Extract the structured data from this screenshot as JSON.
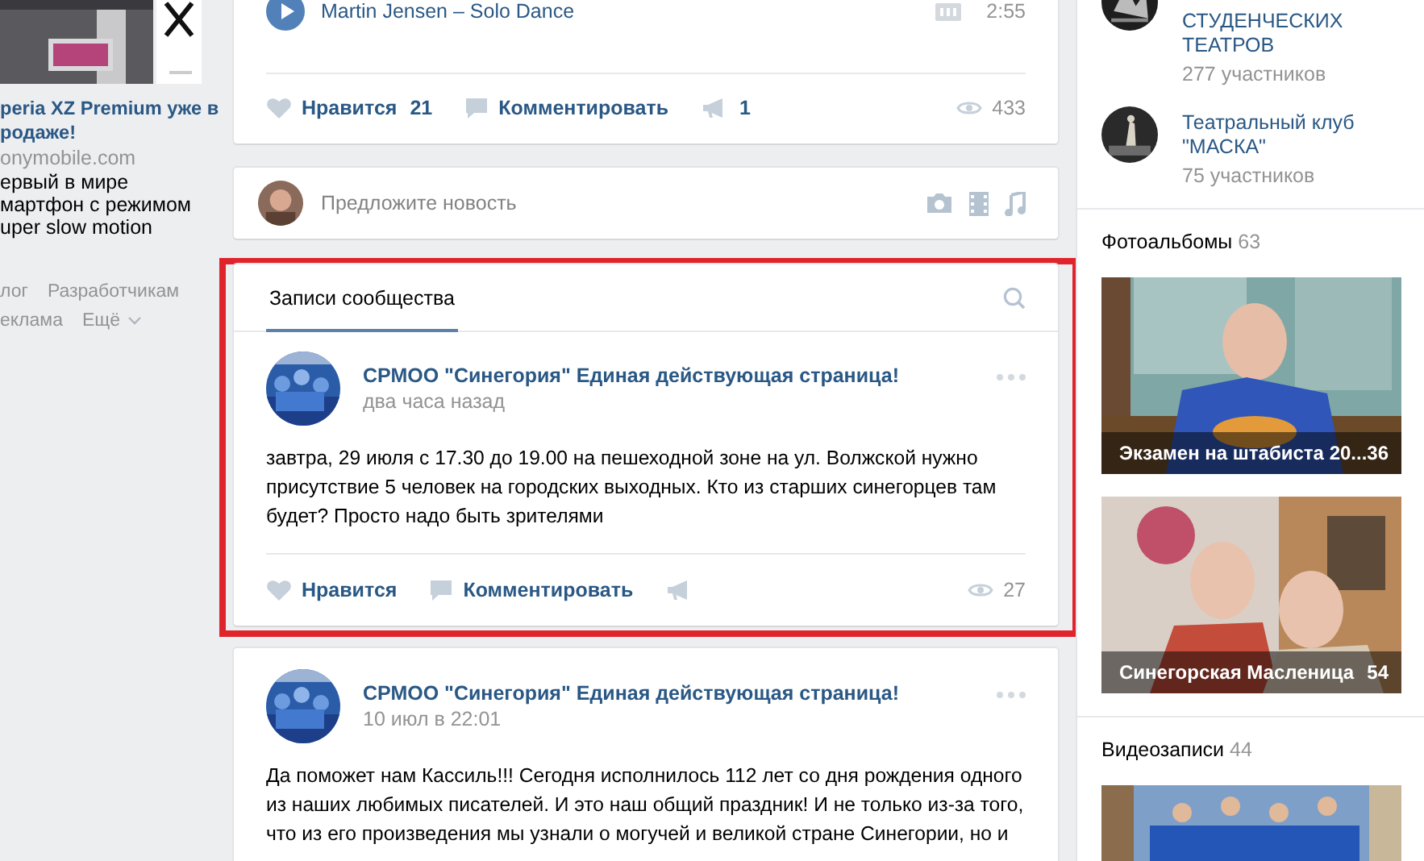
{
  "left_ad": {
    "title_lines": [
      "peria XZ Premium уже в",
      "родаже!"
    ],
    "domain": "onymobile.com",
    "description_lines": [
      "ервый в мире",
      "мартфон с режимом",
      "uper slow motion"
    ]
  },
  "footer_links": [
    {
      "label": "лог",
      "kind": "link"
    },
    {
      "label": "Разработчикам",
      "kind": "link"
    },
    {
      "label": "еклама",
      "kind": "link"
    },
    {
      "label": "Ещё",
      "kind": "menu"
    }
  ],
  "top_post": {
    "audio": {
      "title": "Martin Jensen – Solo Dance",
      "duration": "2:55"
    },
    "like_label": "Нравится",
    "like_count": "21",
    "comment_label": "Комментировать",
    "share_count": "1",
    "views": "433"
  },
  "suggest": {
    "placeholder": "Предложите новость"
  },
  "wall": {
    "highlighted": true,
    "tabs": [
      {
        "label": "Записи сообщества",
        "selected": true
      }
    ],
    "posts": [
      {
        "author": "СРМОО \"Синегория\" Единая действующая страница!",
        "time": "два часа назад",
        "text": "завтра, 29 июля с 17.30 до 19.00 на пешеходной зоне на ул. Волжской нужно присутствие 5 человек на городских выходных. Кто из старших синегорцев там будет? Просто надо быть зрителями",
        "like_label": "Нравится",
        "comment_label": "Комментировать",
        "views": "27"
      }
    ]
  },
  "next_post": {
    "author": "СРМОО \"Синегория\" Единая действующая страница!",
    "time": "10 июл в 22:01",
    "text": "Да поможет нам Кассиль!!! Сегодня исполнилось 112 лет со дня рождения одного из наших любимых писателей. И это наш общий праздник! И не только из-за того, что из его произведения мы узнали о могучей и великой стране Синегории, но и"
  },
  "groups": [
    {
      "name_lines": [
        "СТУДЕНЧЕСКИХ",
        "ТЕАТРОВ"
      ],
      "members": "277 участников"
    },
    {
      "name_lines": [
        "Театральный клуб",
        "\"МАСКА\""
      ],
      "members": "75 участников"
    }
  ],
  "photo_albums": {
    "title": "Фотоальбомы",
    "count": "63",
    "albums": [
      {
        "title": "Экзамен на штабиста 20...",
        "count": "36"
      },
      {
        "title": "Синегорская Масленица",
        "count": "54"
      }
    ]
  },
  "videos": {
    "title": "Видеозаписи",
    "count": "44"
  }
}
